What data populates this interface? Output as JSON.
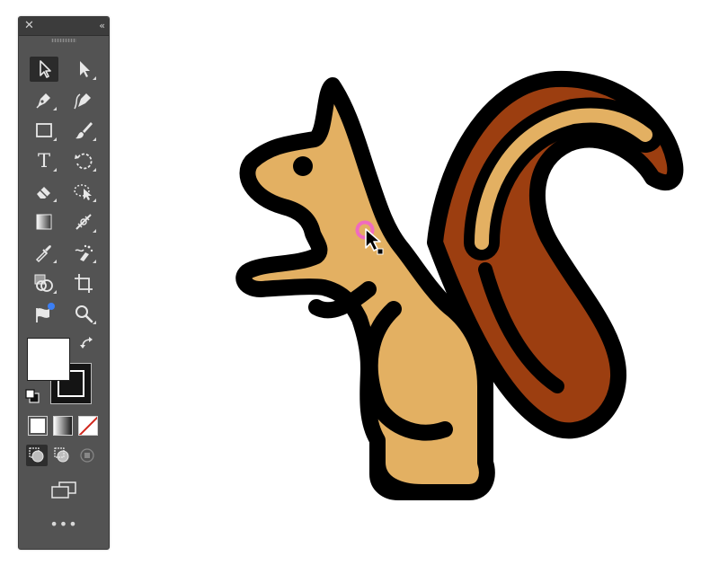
{
  "toolbar": {
    "close_label": "✕",
    "collapse_label": "‹‹",
    "type_tool_label": "T",
    "more_label": "•••",
    "tools": [
      {
        "name": "selection-tool",
        "icon": "selection-arrow-icon",
        "selected": true
      },
      {
        "name": "direct-selection-tool",
        "icon": "direct-selection-arrow-icon"
      },
      {
        "name": "pen-tool",
        "icon": "pen-icon"
      },
      {
        "name": "curvature-tool",
        "icon": "curvature-pen-icon"
      },
      {
        "name": "rectangle-tool",
        "icon": "rectangle-icon"
      },
      {
        "name": "paintbrush-tool",
        "icon": "paintbrush-icon"
      },
      {
        "name": "type-tool",
        "icon": "type-icon"
      },
      {
        "name": "rotate-tool",
        "icon": "rotate-icon"
      },
      {
        "name": "eraser-tool",
        "icon": "eraser-icon"
      },
      {
        "name": "puppet-warp-tool",
        "icon": "puppet-warp-icon"
      },
      {
        "name": "gradient-tool",
        "icon": "gradient-icon"
      },
      {
        "name": "measure-tool",
        "icon": "measure-icon"
      },
      {
        "name": "eyedropper-tool",
        "icon": "eyedropper-icon"
      },
      {
        "name": "symbol-sprayer-tool",
        "icon": "symbol-sprayer-icon"
      },
      {
        "name": "shape-builder-tool",
        "icon": "shape-builder-icon"
      },
      {
        "name": "artboard-tool",
        "icon": "artboard-icon"
      },
      {
        "name": "recolor-tool",
        "icon": "recolor-icon"
      },
      {
        "name": "zoom-tool",
        "icon": "zoom-icon"
      }
    ],
    "fill_color": "#ffffff",
    "stroke_color": "#141414"
  },
  "colors": {
    "panel_bg": "#535353",
    "panel_header": "#3c3c3c",
    "selected_tool_bg": "#2b2b2b",
    "accent_dot": "#3b7ff5"
  },
  "artwork": {
    "subject": "squirrel",
    "body_color": "#e3b062",
    "tail_outer_color": "#9c3e10",
    "tail_stripe_color": "#e3b062",
    "outline_color": "#000000",
    "white_halo": "#ffffff",
    "cursor_ring_color": "#f06bbf"
  }
}
